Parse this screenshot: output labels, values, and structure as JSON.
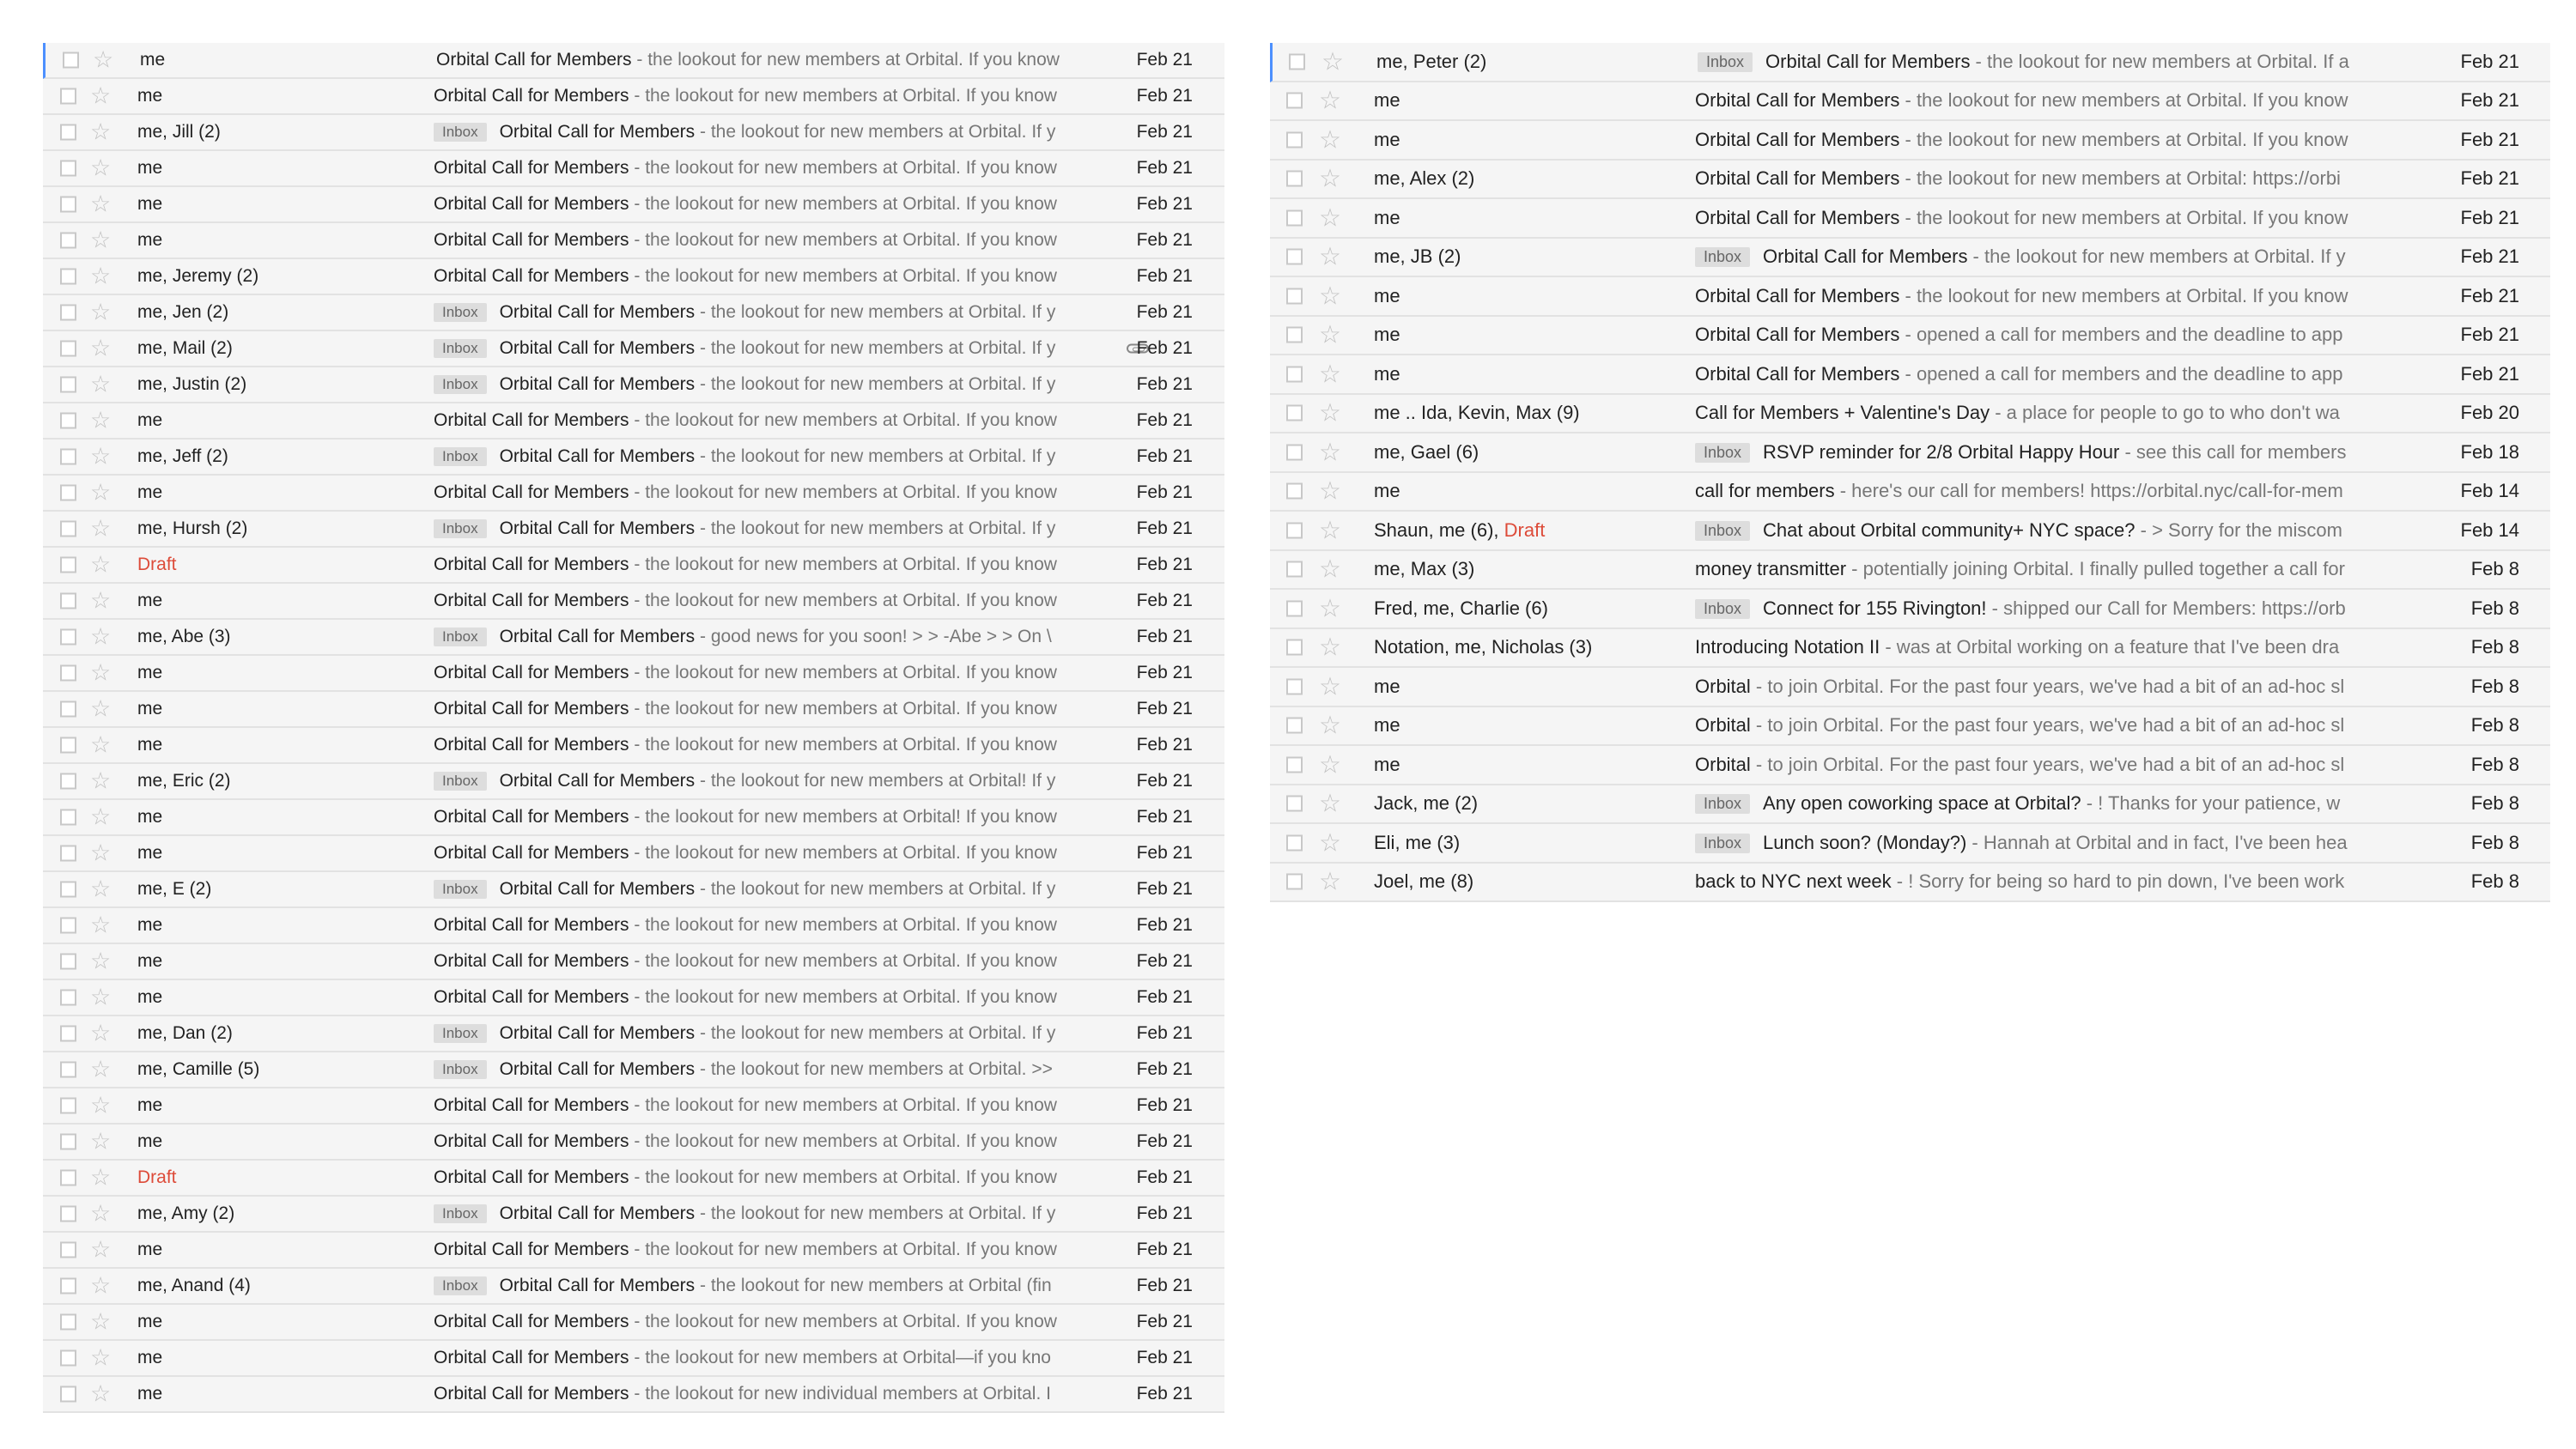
{
  "left_panel": {
    "rows": [
      {
        "sender": "me",
        "label": "",
        "subject": "Orbital Call for Members",
        "snippet": " - the lookout for new members at Orbital. If you know",
        "date": "Feb 21",
        "attachment": false
      },
      {
        "sender": "me",
        "label": "",
        "subject": "Orbital Call for Members",
        "snippet": " - the lookout for new members at Orbital. If you know",
        "date": "Feb 21",
        "attachment": false
      },
      {
        "sender": "me, Jill (2)",
        "label": "Inbox",
        "subject": "Orbital Call for Members",
        "snippet": " - the lookout for new members at Orbital. If y",
        "date": "Feb 21",
        "attachment": false
      },
      {
        "sender": "me",
        "label": "",
        "subject": "Orbital Call for Members",
        "snippet": " - the lookout for new members at Orbital. If you know",
        "date": "Feb 21",
        "attachment": false
      },
      {
        "sender": "me",
        "label": "",
        "subject": "Orbital Call for Members",
        "snippet": " - the lookout for new members at Orbital. If you know",
        "date": "Feb 21",
        "attachment": false
      },
      {
        "sender": "me",
        "label": "",
        "subject": "Orbital Call for Members",
        "snippet": " - the lookout for new members at Orbital. If you know",
        "date": "Feb 21",
        "attachment": false
      },
      {
        "sender": "me, Jeremy (2)",
        "label": "",
        "subject": "Orbital Call for Members",
        "snippet": " - the lookout for new members at Orbital. If you know",
        "date": "Feb 21",
        "attachment": false
      },
      {
        "sender": "me, Jen (2)",
        "label": "Inbox",
        "subject": "Orbital Call for Members",
        "snippet": " - the lookout for new members at Orbital. If y",
        "date": "Feb 21",
        "attachment": false
      },
      {
        "sender": "me, Mail (2)",
        "label": "Inbox",
        "subject": "Orbital Call for Members",
        "snippet": " - the lookout for new members at Orbital. If y",
        "date": "Feb 21",
        "attachment": true
      },
      {
        "sender": "me, Justin (2)",
        "label": "Inbox",
        "subject": "Orbital Call for Members",
        "snippet": " - the lookout for new members at Orbital. If y",
        "date": "Feb 21",
        "attachment": false
      },
      {
        "sender": "me",
        "label": "",
        "subject": "Orbital Call for Members",
        "snippet": " - the lookout for new members at Orbital. If you know",
        "date": "Feb 21",
        "attachment": false
      },
      {
        "sender": "me, Jeff (2)",
        "label": "Inbox",
        "subject": "Orbital Call for Members",
        "snippet": " - the lookout for new members at Orbital. If y",
        "date": "Feb 21",
        "attachment": false
      },
      {
        "sender": "me",
        "label": "",
        "subject": "Orbital Call for Members",
        "snippet": " - the lookout for new members at Orbital. If you know",
        "date": "Feb 21",
        "attachment": false
      },
      {
        "sender": "me, Hursh (2)",
        "label": "Inbox",
        "subject": "Orbital Call for Members",
        "snippet": " - the lookout for new members at Orbital. If y",
        "date": "Feb 21",
        "attachment": false
      },
      {
        "sender": "",
        "draft": "Draft",
        "label": "",
        "subject": "Orbital Call for Members",
        "snippet": " - the lookout for new members at Orbital. If you know",
        "date": "Feb 21",
        "attachment": false
      },
      {
        "sender": "me",
        "label": "",
        "subject": "Orbital Call for Members",
        "snippet": " - the lookout for new members at Orbital. If you know",
        "date": "Feb 21",
        "attachment": false
      },
      {
        "sender": "me, Abe (3)",
        "label": "Inbox",
        "subject": "Orbital Call for Members",
        "snippet": " - good news for you soon! > > -Abe > > On \\",
        "date": "Feb 21",
        "attachment": false
      },
      {
        "sender": "me",
        "label": "",
        "subject": "Orbital Call for Members",
        "snippet": " - the lookout for new members at Orbital. If you know",
        "date": "Feb 21",
        "attachment": false
      },
      {
        "sender": "me",
        "label": "",
        "subject": "Orbital Call for Members",
        "snippet": " - the lookout for new members at Orbital. If you know",
        "date": "Feb 21",
        "attachment": false
      },
      {
        "sender": "me",
        "label": "",
        "subject": "Orbital Call for Members",
        "snippet": " - the lookout for new members at Orbital. If you know",
        "date": "Feb 21",
        "attachment": false
      },
      {
        "sender": "me, Eric (2)",
        "label": "Inbox",
        "subject": "Orbital Call for Members",
        "snippet": " - the lookout for new members at Orbital! If y",
        "date": "Feb 21",
        "attachment": false
      },
      {
        "sender": "me",
        "label": "",
        "subject": "Orbital Call for Members",
        "snippet": " - the lookout for new members at Orbital! If you know",
        "date": "Feb 21",
        "attachment": false
      },
      {
        "sender": "me",
        "label": "",
        "subject": "Orbital Call for Members",
        "snippet": " - the lookout for new members at Orbital. If you know",
        "date": "Feb 21",
        "attachment": false
      },
      {
        "sender": "me, E (2)",
        "label": "Inbox",
        "subject": "Orbital Call for Members",
        "snippet": " - the lookout for new members at Orbital. If y",
        "date": "Feb 21",
        "attachment": false
      },
      {
        "sender": "me",
        "label": "",
        "subject": "Orbital Call for Members",
        "snippet": " - the lookout for new members at Orbital. If you know",
        "date": "Feb 21",
        "attachment": false
      },
      {
        "sender": "me",
        "label": "",
        "subject": "Orbital Call for Members",
        "snippet": " - the lookout for new members at Orbital. If you know",
        "date": "Feb 21",
        "attachment": false
      },
      {
        "sender": "me",
        "label": "",
        "subject": "Orbital Call for Members",
        "snippet": " - the lookout for new members at Orbital. If you know",
        "date": "Feb 21",
        "attachment": false
      },
      {
        "sender": "me, Dan (2)",
        "label": "Inbox",
        "subject": "Orbital Call for Members",
        "snippet": " - the lookout for new members at Orbital. If y",
        "date": "Feb 21",
        "attachment": false
      },
      {
        "sender": "me, Camille (5)",
        "label": "Inbox",
        "subject": "Orbital Call for Members",
        "snippet": " - the lookout for new members at Orbital. >>",
        "date": "Feb 21",
        "attachment": false
      },
      {
        "sender": "me",
        "label": "",
        "subject": "Orbital Call for Members",
        "snippet": " - the lookout for new members at Orbital. If you know",
        "date": "Feb 21",
        "attachment": false
      },
      {
        "sender": "me",
        "label": "",
        "subject": "Orbital Call for Members",
        "snippet": " - the lookout for new members at Orbital. If you know",
        "date": "Feb 21",
        "attachment": false
      },
      {
        "sender": "",
        "draft": "Draft",
        "label": "",
        "subject": "Orbital Call for Members",
        "snippet": " - the lookout for new members at Orbital. If you know",
        "date": "Feb 21",
        "attachment": false
      },
      {
        "sender": "me, Amy (2)",
        "label": "Inbox",
        "subject": "Orbital Call for Members",
        "snippet": " - the lookout for new members at Orbital. If y",
        "date": "Feb 21",
        "attachment": false
      },
      {
        "sender": "me",
        "label": "",
        "subject": "Orbital Call for Members",
        "snippet": " - the lookout for new members at Orbital. If you know",
        "date": "Feb 21",
        "attachment": false
      },
      {
        "sender": "me, Anand (4)",
        "label": "Inbox",
        "subject": "Orbital Call for Members",
        "snippet": " - the lookout for new members at Orbital (fin",
        "date": "Feb 21",
        "attachment": false
      },
      {
        "sender": "me",
        "label": "",
        "subject": "Orbital Call for Members",
        "snippet": " - the lookout for new members at Orbital. If you know",
        "date": "Feb 21",
        "attachment": false
      },
      {
        "sender": "me",
        "label": "",
        "subject": "Orbital Call for Members",
        "snippet": " - the lookout for new members at Orbital—if you kno",
        "date": "Feb 21",
        "attachment": false
      },
      {
        "sender": "me",
        "label": "",
        "subject": "Orbital Call for Members",
        "snippet": " - the lookout for new individual members at Orbital. I",
        "date": "Feb 21",
        "attachment": false
      }
    ]
  },
  "right_panel": {
    "rows": [
      {
        "sender": "me, Peter (2)",
        "label": "Inbox",
        "subject": "Orbital Call for Members",
        "snippet": " - the lookout for new members at Orbital. If a",
        "date": "Feb 21"
      },
      {
        "sender": "me",
        "label": "",
        "subject": "Orbital Call for Members",
        "snippet": " - the lookout for new members at Orbital. If you know",
        "date": "Feb 21"
      },
      {
        "sender": "me",
        "label": "",
        "subject": "Orbital Call for Members",
        "snippet": " - the lookout for new members at Orbital. If you know",
        "date": "Feb 21"
      },
      {
        "sender": "me, Alex (2)",
        "label": "",
        "subject": "Orbital Call for Members",
        "snippet": " - the lookout for new members at Orbital: https://orbi",
        "date": "Feb 21"
      },
      {
        "sender": "me",
        "label": "",
        "subject": "Orbital Call for Members",
        "snippet": " - the lookout for new members at Orbital. If you know",
        "date": "Feb 21"
      },
      {
        "sender": "me, JB (2)",
        "label": "Inbox",
        "subject": "Orbital Call for Members",
        "snippet": " - the lookout for new members at Orbital. If y",
        "date": "Feb 21"
      },
      {
        "sender": "me",
        "label": "",
        "subject": "Orbital Call for Members",
        "snippet": " - the lookout for new members at Orbital. If you know",
        "date": "Feb 21"
      },
      {
        "sender": "me",
        "label": "",
        "subject": "Orbital Call for Members",
        "snippet": " - opened a call for members and the deadline to app",
        "date": "Feb 21"
      },
      {
        "sender": "me",
        "label": "",
        "subject": "Orbital Call for Members",
        "snippet": " - opened a call for members and the deadline to app",
        "date": "Feb 21"
      },
      {
        "sender": "me .. Ida, Kevin, Max (9)",
        "label": "",
        "subject": "Call for Members + Valentine's Day",
        "snippet": " - a place for people to go to who don't wa",
        "date": "Feb 20"
      },
      {
        "sender": "me, Gael (6)",
        "label": "Inbox",
        "subject": "RSVP reminder for 2/8 Orbital Happy Hour",
        "snippet": " - see this call for members",
        "date": "Feb 18"
      },
      {
        "sender": "me",
        "label": "",
        "subject": "call for members",
        "snippet": " - here's our call for members! https://orbital.nyc/call-for-mem",
        "date": "Feb 14"
      },
      {
        "sender": "Shaun, me (6), ",
        "draft": "Draft",
        "label": "Inbox",
        "subject": "Chat about Orbital community+ NYC space?",
        "snippet": " - > Sorry for the miscom",
        "date": "Feb 14"
      },
      {
        "sender": "me, Max (3)",
        "label": "",
        "subject": "money transmitter",
        "snippet": " - potentially joining Orbital. I finally pulled together a call for",
        "date": "Feb 8"
      },
      {
        "sender": "Fred, me, Charlie (6)",
        "label": "Inbox",
        "subject": "Connect for 155 Rivington!",
        "snippet": " - shipped our Call for Members: https://orb",
        "date": "Feb 8"
      },
      {
        "sender": "Notation, me, Nicholas (3)",
        "label": "",
        "subject": "Introducing Notation II",
        "snippet": " - was at Orbital working on a feature that I've been dra",
        "date": "Feb 8"
      },
      {
        "sender": "me",
        "label": "",
        "subject": "Orbital",
        "snippet": " - to join Orbital. For the past four years, we've had a bit of an ad-hoc sl",
        "date": "Feb 8"
      },
      {
        "sender": "me",
        "label": "",
        "subject": "Orbital",
        "snippet": " - to join Orbital. For the past four years, we've had a bit of an ad-hoc sl",
        "date": "Feb 8"
      },
      {
        "sender": "me",
        "label": "",
        "subject": "Orbital",
        "snippet": " - to join Orbital. For the past four years, we've had a bit of an ad-hoc sl",
        "date": "Feb 8"
      },
      {
        "sender": "Jack, me (2)",
        "label": "Inbox",
        "subject": "Any open coworking space at Orbital?",
        "snippet": " - ! Thanks for your patience, w",
        "date": "Feb 8"
      },
      {
        "sender": "Eli, me (3)",
        "label": "Inbox",
        "subject": "Lunch soon? (Monday?)",
        "snippet": " - Hannah at Orbital and in fact, I've been hea",
        "date": "Feb 8"
      },
      {
        "sender": "Joel, me (8)",
        "label": "",
        "subject": "back to NYC next week",
        "snippet": " - ! Sorry for being so hard to pin down, I've been work",
        "date": "Feb 8"
      }
    ]
  }
}
